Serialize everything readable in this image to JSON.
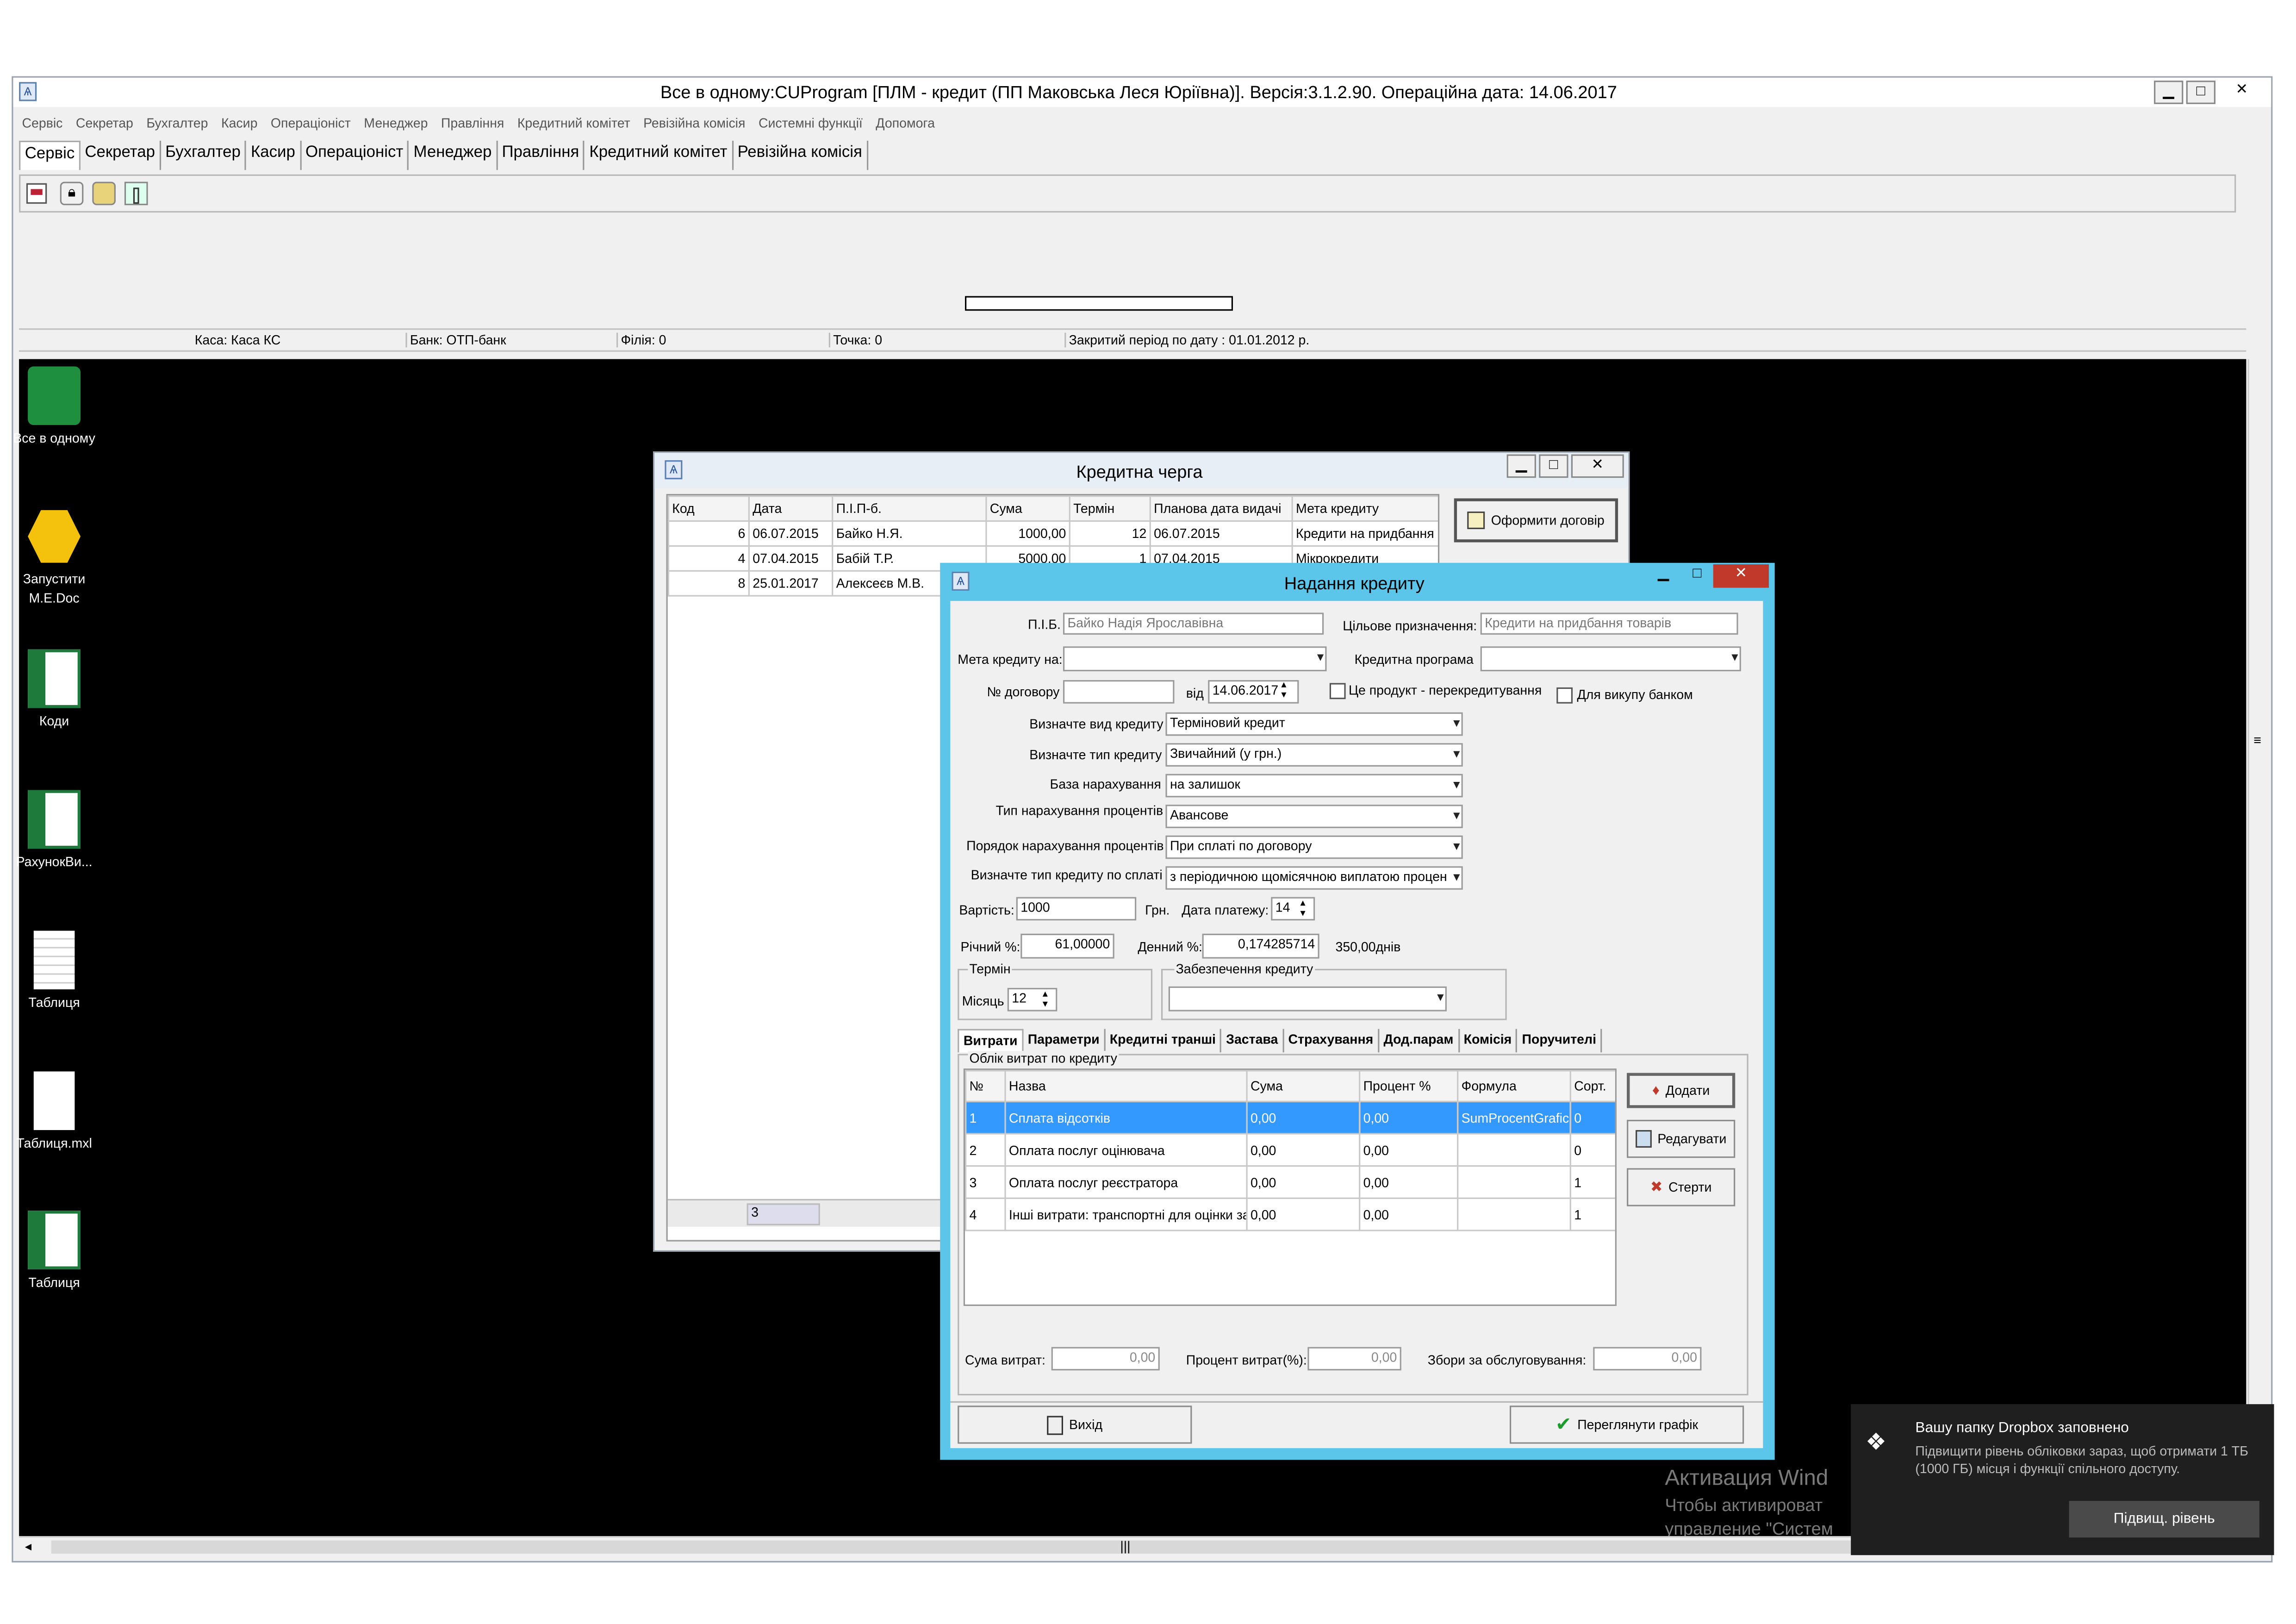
{
  "app": {
    "title": "Все в одному:CUProgram   [ПЛМ - кредит (ПП Маковська Леся Юріївна)]. Версія:3.1.2.90.  Операційна дата: 14.06.2017",
    "menu": [
      "Сервіс",
      "Секретар",
      "Бухгалтер",
      "Касир",
      "Операціоніст",
      "Менеджер",
      "Правління",
      "Кредитний комітет",
      "Ревізійна комісія",
      "Системні функції",
      "Допомога"
    ],
    "tabs": [
      "Сервіс",
      "Секретар",
      "Бухгалтер",
      "Касир",
      "Операціоніст",
      "Менеджер",
      "Правління",
      "Кредитний комітет",
      "Ревізійна комісія"
    ],
    "status": {
      "kasa": "Каса: Каса КС",
      "bank": "Банк: ОТП-банк",
      "filia": "Філія: 0",
      "tochka": "Точка: 0",
      "period": "Закритий період по дату : 01.01.2012 р."
    }
  },
  "desktop": [
    {
      "label": "Все в одному",
      "icon": "app-logo-icon"
    },
    {
      "label": "Запустити M.E.Doc",
      "icon": "honeycomb-icon"
    },
    {
      "label": "Коди",
      "icon": "excel-icon"
    },
    {
      "label": "РахунокВи...",
      "icon": "excel-icon"
    },
    {
      "label": "Таблиця",
      "icon": "text-file-icon"
    },
    {
      "label": "Таблиця.mxl",
      "icon": "blank-file-icon"
    },
    {
      "label": "Таблиця",
      "icon": "excel-icon"
    }
  ],
  "queue": {
    "title": "Кредитна черга",
    "columns": [
      "Код",
      "Дата",
      "П.І.П-б.",
      "Сума",
      "Термін",
      "Планова дата видачі",
      "Мета кредиту"
    ],
    "rows": [
      [
        "6",
        "06.07.2015",
        "Байко Н.Я.",
        "1000,00",
        "12",
        "06.07.2015",
        "Кредити на придбання това"
      ],
      [
        "4",
        "07.04.2015",
        "Бабій Т.Р.",
        "5000,00",
        "1",
        "07.04.2015",
        "Мікрокредити"
      ],
      [
        "8",
        "25.01.2017",
        "Алексеєв М.В.",
        "",
        "",
        "",
        ""
      ]
    ],
    "count": "3",
    "make_contract": "Оформити договір"
  },
  "credit": {
    "title": "Надання кредиту",
    "pib_label": "П.І.Б.",
    "pib_value": "Байко Надія Ярославівна",
    "purpose_label": "Цільове призначення:",
    "purpose_value": "Кредити на придбання товарів",
    "goal_label": "Мета кредиту на:",
    "program_label": "Кредитна програма",
    "contract_label": "№ договору",
    "from_label": "від",
    "date_value": "14.06.2017",
    "refinance_label": "Це продукт - перекредитування",
    "buyout_label": "Для викупу банком",
    "kind_label": "Визначте вид кредиту",
    "kind_value": "Терміновий кредит",
    "type_label": "Визначте тип кредиту",
    "type_value": "Звичайний (у грн.)",
    "base_label": "База нарахування",
    "base_value": "на залишок",
    "interest_type_label": "Тип нарахування процентів",
    "interest_type_value": "Авансове",
    "order_label": "Порядок нарахування процентів",
    "order_value": "При сплаті по договору",
    "repay_label": "Визначте тип кредиту по сплаті",
    "repay_value": "з періодичною щомісячною виплатою процен",
    "cost_label": "Вартість:",
    "cost_value": "1000",
    "currency": "Грн.",
    "pay_date_label": "Дата платежу:",
    "pay_date_value": "14",
    "annual_label": "Річний %:",
    "annual_value": "61,00000",
    "daily_label": "Денний %:",
    "daily_value": "0,174285714",
    "days_text": "350,00днів",
    "term_group": "Термін",
    "month_label": "Місяць",
    "month_value": "12",
    "security_group": "Забезпечення кредиту",
    "tabs": [
      "Витрати",
      "Параметри",
      "Кредитні транші",
      "Застава",
      "Страхування",
      "Дод.парам",
      "Комісія",
      "Поручителі"
    ],
    "expenses_group": "Облік витрат по кредиту",
    "exp_columns": [
      "№",
      "Назва",
      "Сума",
      "Процент %",
      "Формула",
      "Сорт."
    ],
    "exp_rows": [
      [
        "1",
        "Сплата відсотків",
        "0,00",
        "0,00",
        "SumProcentGrafic",
        "0"
      ],
      [
        "2",
        "Оплата послуг оцінювача",
        "0,00",
        "0,00",
        "",
        "0"
      ],
      [
        "3",
        "Оплата послуг реєстратора",
        "0,00",
        "0,00",
        "",
        "1"
      ],
      [
        "4",
        "Інші витрати: транспортні для оцінки за",
        "0,00",
        "0,00",
        "",
        "1"
      ]
    ],
    "add": "Додати",
    "edit": "Редагувати",
    "delete": "Стерти",
    "sum_label": "Сума витрат:",
    "sum_value": "0,00",
    "pct_label": "Процент витрат(%):",
    "pct_value": "0,00",
    "fee_label": "Збори за обслуговування:",
    "fee_value": "0,00",
    "exit": "Вихід",
    "schedule": "Переглянути графік"
  },
  "watermark": {
    "line1": "Активация Wind",
    "line2": "Чтобы активироват",
    "line3": "управление \"Систем"
  },
  "toast": {
    "title": "Вашу папку Dropbox заповнено",
    "body": "Підвищити рівень обліковки зараз, щоб отримати 1 ТБ (1000 ГБ) місця і функції спільного доступу.",
    "button": "Підвищ. рівень"
  }
}
